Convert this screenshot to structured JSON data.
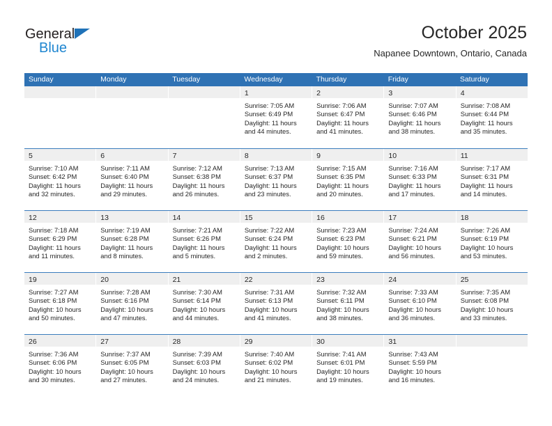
{
  "brand": {
    "line1": "General",
    "line2": "Blue",
    "triangle_icon": "brand-triangle-icon",
    "accent_color": "#1f86d0"
  },
  "header": {
    "title": "October 2025",
    "subtitle": "Napanee Downtown, Ontario, Canada"
  },
  "theme": {
    "header_blue": "#2f72b4",
    "row_divider_blue": "#3a7cbd",
    "daynum_band": "#efefef",
    "text": "#262626"
  },
  "weekdays": [
    "Sunday",
    "Monday",
    "Tuesday",
    "Wednesday",
    "Thursday",
    "Friday",
    "Saturday"
  ],
  "labels": {
    "sunrise_prefix": "Sunrise:",
    "sunset_prefix": "Sunset:",
    "daylight_prefix": "Daylight:"
  },
  "weeks": [
    [
      {
        "day": "",
        "lines": []
      },
      {
        "day": "",
        "lines": []
      },
      {
        "day": "",
        "lines": []
      },
      {
        "day": "1",
        "lines": [
          "Sunrise: 7:05 AM",
          "Sunset: 6:49 PM",
          "Daylight: 11 hours",
          "and 44 minutes."
        ]
      },
      {
        "day": "2",
        "lines": [
          "Sunrise: 7:06 AM",
          "Sunset: 6:47 PM",
          "Daylight: 11 hours",
          "and 41 minutes."
        ]
      },
      {
        "day": "3",
        "lines": [
          "Sunrise: 7:07 AM",
          "Sunset: 6:46 PM",
          "Daylight: 11 hours",
          "and 38 minutes."
        ]
      },
      {
        "day": "4",
        "lines": [
          "Sunrise: 7:08 AM",
          "Sunset: 6:44 PM",
          "Daylight: 11 hours",
          "and 35 minutes."
        ]
      }
    ],
    [
      {
        "day": "5",
        "lines": [
          "Sunrise: 7:10 AM",
          "Sunset: 6:42 PM",
          "Daylight: 11 hours",
          "and 32 minutes."
        ]
      },
      {
        "day": "6",
        "lines": [
          "Sunrise: 7:11 AM",
          "Sunset: 6:40 PM",
          "Daylight: 11 hours",
          "and 29 minutes."
        ]
      },
      {
        "day": "7",
        "lines": [
          "Sunrise: 7:12 AM",
          "Sunset: 6:38 PM",
          "Daylight: 11 hours",
          "and 26 minutes."
        ]
      },
      {
        "day": "8",
        "lines": [
          "Sunrise: 7:13 AM",
          "Sunset: 6:37 PM",
          "Daylight: 11 hours",
          "and 23 minutes."
        ]
      },
      {
        "day": "9",
        "lines": [
          "Sunrise: 7:15 AM",
          "Sunset: 6:35 PM",
          "Daylight: 11 hours",
          "and 20 minutes."
        ]
      },
      {
        "day": "10",
        "lines": [
          "Sunrise: 7:16 AM",
          "Sunset: 6:33 PM",
          "Daylight: 11 hours",
          "and 17 minutes."
        ]
      },
      {
        "day": "11",
        "lines": [
          "Sunrise: 7:17 AM",
          "Sunset: 6:31 PM",
          "Daylight: 11 hours",
          "and 14 minutes."
        ]
      }
    ],
    [
      {
        "day": "12",
        "lines": [
          "Sunrise: 7:18 AM",
          "Sunset: 6:29 PM",
          "Daylight: 11 hours",
          "and 11 minutes."
        ]
      },
      {
        "day": "13",
        "lines": [
          "Sunrise: 7:19 AM",
          "Sunset: 6:28 PM",
          "Daylight: 11 hours",
          "and 8 minutes."
        ]
      },
      {
        "day": "14",
        "lines": [
          "Sunrise: 7:21 AM",
          "Sunset: 6:26 PM",
          "Daylight: 11 hours",
          "and 5 minutes."
        ]
      },
      {
        "day": "15",
        "lines": [
          "Sunrise: 7:22 AM",
          "Sunset: 6:24 PM",
          "Daylight: 11 hours",
          "and 2 minutes."
        ]
      },
      {
        "day": "16",
        "lines": [
          "Sunrise: 7:23 AM",
          "Sunset: 6:23 PM",
          "Daylight: 10 hours",
          "and 59 minutes."
        ]
      },
      {
        "day": "17",
        "lines": [
          "Sunrise: 7:24 AM",
          "Sunset: 6:21 PM",
          "Daylight: 10 hours",
          "and 56 minutes."
        ]
      },
      {
        "day": "18",
        "lines": [
          "Sunrise: 7:26 AM",
          "Sunset: 6:19 PM",
          "Daylight: 10 hours",
          "and 53 minutes."
        ]
      }
    ],
    [
      {
        "day": "19",
        "lines": [
          "Sunrise: 7:27 AM",
          "Sunset: 6:18 PM",
          "Daylight: 10 hours",
          "and 50 minutes."
        ]
      },
      {
        "day": "20",
        "lines": [
          "Sunrise: 7:28 AM",
          "Sunset: 6:16 PM",
          "Daylight: 10 hours",
          "and 47 minutes."
        ]
      },
      {
        "day": "21",
        "lines": [
          "Sunrise: 7:30 AM",
          "Sunset: 6:14 PM",
          "Daylight: 10 hours",
          "and 44 minutes."
        ]
      },
      {
        "day": "22",
        "lines": [
          "Sunrise: 7:31 AM",
          "Sunset: 6:13 PM",
          "Daylight: 10 hours",
          "and 41 minutes."
        ]
      },
      {
        "day": "23",
        "lines": [
          "Sunrise: 7:32 AM",
          "Sunset: 6:11 PM",
          "Daylight: 10 hours",
          "and 38 minutes."
        ]
      },
      {
        "day": "24",
        "lines": [
          "Sunrise: 7:33 AM",
          "Sunset: 6:10 PM",
          "Daylight: 10 hours",
          "and 36 minutes."
        ]
      },
      {
        "day": "25",
        "lines": [
          "Sunrise: 7:35 AM",
          "Sunset: 6:08 PM",
          "Daylight: 10 hours",
          "and 33 minutes."
        ]
      }
    ],
    [
      {
        "day": "26",
        "lines": [
          "Sunrise: 7:36 AM",
          "Sunset: 6:06 PM",
          "Daylight: 10 hours",
          "and 30 minutes."
        ]
      },
      {
        "day": "27",
        "lines": [
          "Sunrise: 7:37 AM",
          "Sunset: 6:05 PM",
          "Daylight: 10 hours",
          "and 27 minutes."
        ]
      },
      {
        "day": "28",
        "lines": [
          "Sunrise: 7:39 AM",
          "Sunset: 6:03 PM",
          "Daylight: 10 hours",
          "and 24 minutes."
        ]
      },
      {
        "day": "29",
        "lines": [
          "Sunrise: 7:40 AM",
          "Sunset: 6:02 PM",
          "Daylight: 10 hours",
          "and 21 minutes."
        ]
      },
      {
        "day": "30",
        "lines": [
          "Sunrise: 7:41 AM",
          "Sunset: 6:01 PM",
          "Daylight: 10 hours",
          "and 19 minutes."
        ]
      },
      {
        "day": "31",
        "lines": [
          "Sunrise: 7:43 AM",
          "Sunset: 5:59 PM",
          "Daylight: 10 hours",
          "and 16 minutes."
        ]
      },
      {
        "day": "",
        "lines": []
      }
    ]
  ]
}
